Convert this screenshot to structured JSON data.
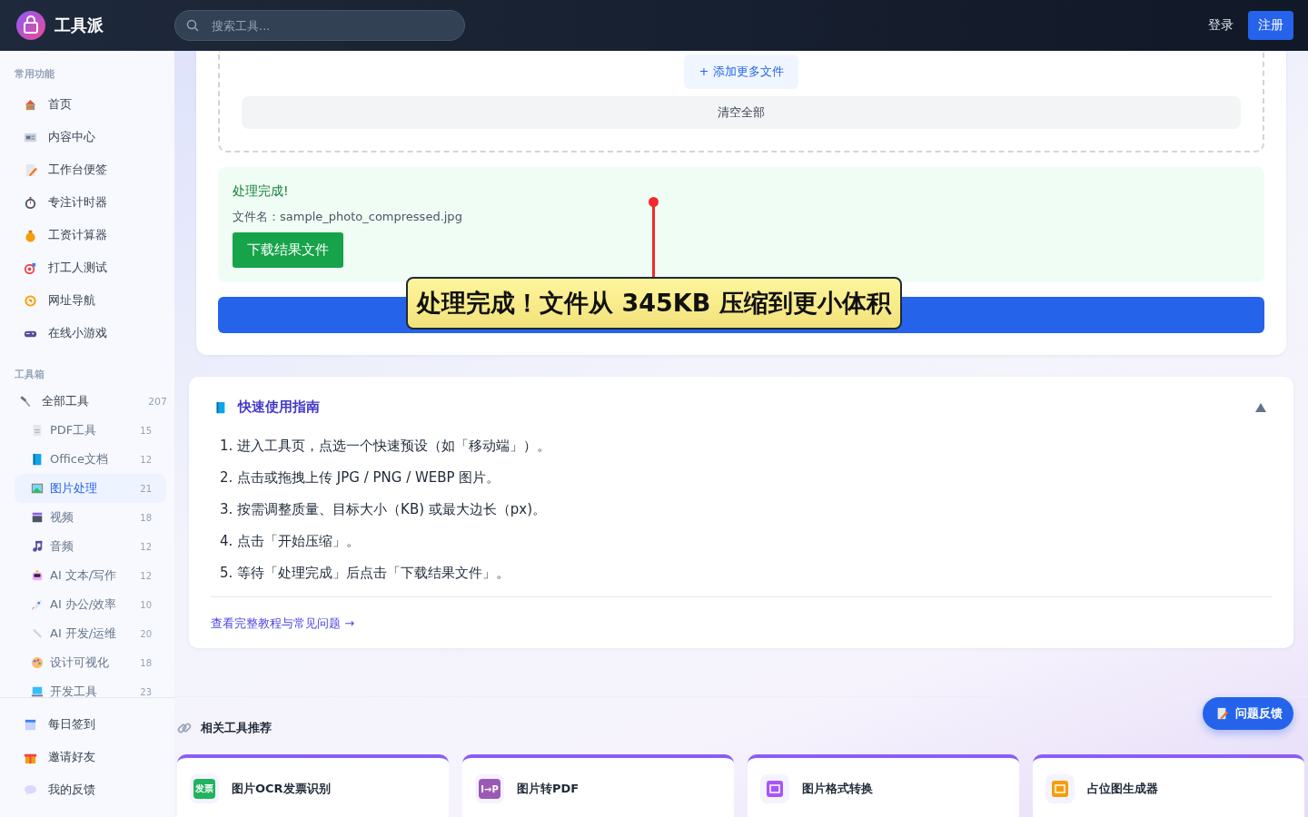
{
  "header": {
    "logo": "工具派",
    "search": {
      "placeholder": "搜索工具..."
    },
    "login": "登录",
    "register": "注册"
  },
  "sidebar": {
    "common": {
      "title": "常用功能",
      "items": [
        {
          "label": "首页"
        },
        {
          "label": "内容中心"
        },
        {
          "label": "工作台便签"
        },
        {
          "label": "专注计时器"
        },
        {
          "label": "工资计算器"
        },
        {
          "label": "打工人测试"
        },
        {
          "label": "网址导航"
        },
        {
          "label": "在线小游戏"
        }
      ]
    },
    "toolbox": {
      "title": "工具箱",
      "all": {
        "label": "全部工具",
        "count": "207"
      },
      "items": [
        {
          "label": "PDF工具",
          "count": "15",
          "selected": false
        },
        {
          "label": "Office文档",
          "count": "12",
          "selected": false
        },
        {
          "label": "图片处理",
          "count": "21",
          "selected": true
        },
        {
          "label": "视频",
          "count": "18",
          "selected": false
        },
        {
          "label": "音频",
          "count": "12",
          "selected": false
        },
        {
          "label": "AI 文本/写作",
          "count": "12",
          "selected": false
        },
        {
          "label": "AI 办公/效率",
          "count": "10",
          "selected": false
        },
        {
          "label": "AI 开发/运维",
          "count": "20",
          "selected": false
        },
        {
          "label": "设计可视化",
          "count": "18",
          "selected": false
        },
        {
          "label": "开发工具",
          "count": "23",
          "selected": false
        }
      ]
    },
    "bottom_items": [
      {
        "label": "每日签到"
      },
      {
        "label": "邀请好友"
      },
      {
        "label": "我的反馈"
      }
    ]
  },
  "upload": {
    "add_button": "+ 添加更多文件",
    "clear_button": "清空全部"
  },
  "result": {
    "title": "处理完成!",
    "filename": "文件名：sample_photo_compressed.jpg",
    "download_button": "下载结果文件"
  },
  "annotation": "处理完成！文件从 345KB 压缩到更小体积",
  "guide": {
    "title": "快速使用指南",
    "expanded": true,
    "steps": [
      "1. 进入工具页，点选一个快速预设（如「移动端」）。",
      "2. 点击或拖拽上传 JPG / PNG / WEBP 图片。",
      "3. 按需调整质量、目标大小（KB) 或最大边长（px)。",
      "4. 点击「开始压缩」。",
      "5. 等待「处理完成」后点击「下载结果文件」。"
    ],
    "link": "查看完整教程与常见问题 →"
  },
  "related": {
    "title": "相关工具推荐",
    "cards": [
      {
        "name": "图片OCR发票识别",
        "icon_text": "发票",
        "color": "#22b35e"
      },
      {
        "name": "图片转PDF",
        "icon_text": "I→P",
        "color": "#9b59b6"
      },
      {
        "name": "图片格式转换",
        "color": "#a855f7"
      },
      {
        "name": "占位图生成器",
        "color": "#f59e0b"
      }
    ]
  },
  "feedback_button": "问题反馈"
}
